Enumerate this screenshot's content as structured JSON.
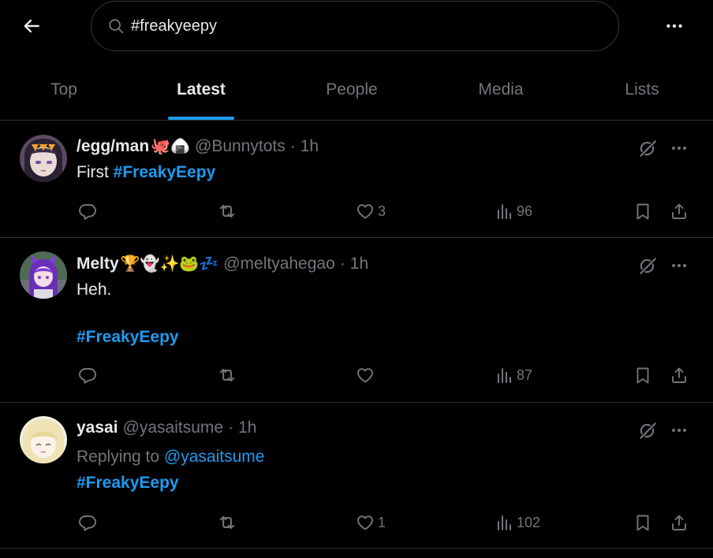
{
  "search": {
    "value": "#freakyeepy"
  },
  "tabs": [
    {
      "label": "Top"
    },
    {
      "label": "Latest"
    },
    {
      "label": "People"
    },
    {
      "label": "Media"
    },
    {
      "label": "Lists"
    }
  ],
  "accent_color": "#1d9bf0",
  "tweets": [
    {
      "name": "/egg/man",
      "name_emoji": "🐙🍙",
      "handle": "@Bunnytots",
      "dot": "·",
      "time": "1h",
      "text_prefix": "First ",
      "hashtag": "#FreakyEepy",
      "likes": "3",
      "views": "96"
    },
    {
      "name": "Melty",
      "name_emoji": "🏆👻✨🐸💤",
      "handle": "@meltyahegao",
      "dot": "·",
      "time": "1h",
      "text": "Heh.",
      "hashtag": "#FreakyEepy",
      "likes": "",
      "views": "87"
    },
    {
      "name": "yasai",
      "handle": "@yasaitsume",
      "dot": "·",
      "time": "1h",
      "replying_to_label": "Replying to ",
      "replying_to_handle": "@yasaitsume",
      "hashtag": "#FreakyEepy",
      "likes": "1",
      "views": "102"
    }
  ]
}
